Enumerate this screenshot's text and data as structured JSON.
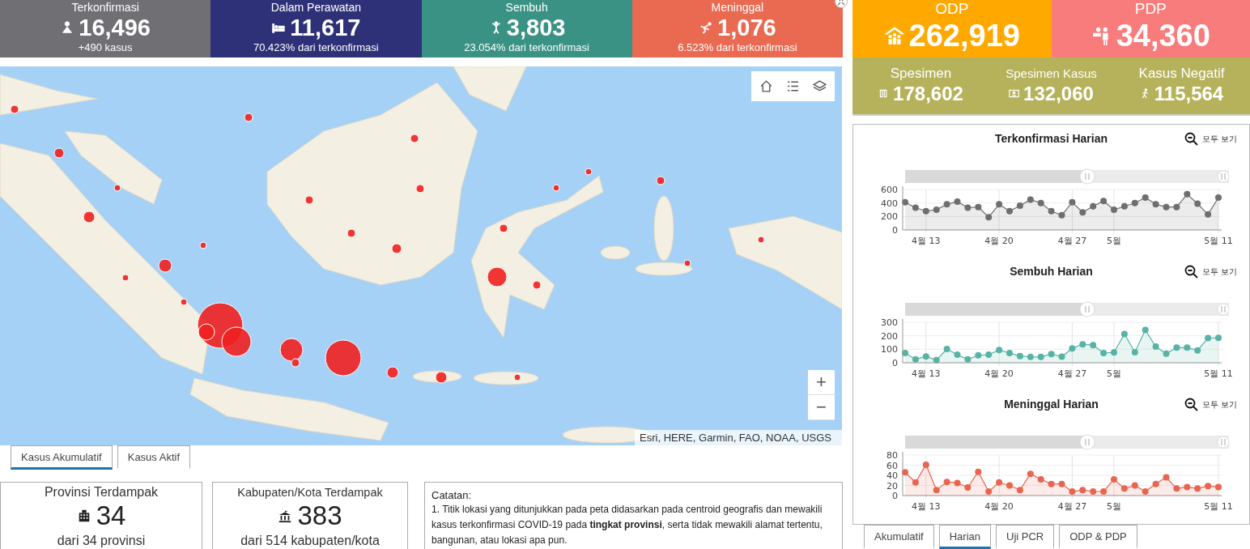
{
  "top_stats": [
    {
      "label": "Terkonfirmasi",
      "value": "16,496",
      "sub": "+490 kasus",
      "color": "#6f6f74",
      "kind": "patient"
    },
    {
      "label": "Dalam Perawatan",
      "value": "11,617",
      "sub": "70.423% dari terkonfirmasi",
      "color": "#2e3177",
      "kind": "bed"
    },
    {
      "label": "Sembuh",
      "value": "3,803",
      "sub": "23.054% dari terkonfirmasi",
      "color": "#3a9285",
      "kind": "cheer"
    },
    {
      "label": "Meninggal",
      "value": "1,076",
      "sub": "6.523% dari terkonfirmasi",
      "color": "#e96a50",
      "kind": "fall"
    }
  ],
  "big_stats": [
    {
      "label": "ODP",
      "value": "262,919",
      "color": "#ffa900",
      "kind": "house"
    },
    {
      "label": "PDP",
      "value": "34,360",
      "color": "#f97c7c",
      "kind": "people"
    }
  ],
  "specimen_stats": [
    {
      "label": "Spesimen",
      "value": "178,602",
      "kind": "tubes"
    },
    {
      "label": "Spesimen Kasus",
      "value": "132,060",
      "kind": "card"
    },
    {
      "label": "Kasus Negatif",
      "value": "115,564",
      "kind": "walk"
    }
  ],
  "map": {
    "attribution": "Esri, HERE, Garmin, FAO, NOAA, USGS",
    "zoom_in": "+",
    "zoom_out": "−"
  },
  "map_tabs": [
    {
      "label": "Kasus Akumulatif",
      "selected": true
    },
    {
      "label": "Kasus Aktif",
      "selected": false
    }
  ],
  "region_cards": [
    {
      "title": "Provinsi Terdampak",
      "value": "34",
      "sub": "dari 34 provinsi",
      "kind": "building"
    },
    {
      "title": "Kabupaten/Kota Terdampak",
      "value": "383",
      "sub": "dari 514 kabupaten/kota",
      "kind": "monument"
    }
  ],
  "note": {
    "title": "Catatan:",
    "text": "1. Titik lokasi yang ditunjukkan pada peta didasarkan pada centroid geografis dan mewakili kasus terkonfirmasi COVID-19 pada **tingkat provinsi**, serta tidak mewakili alamat tertentu, bangunan, atau lokasi apa pun."
  },
  "charts": [
    {
      "reset_label": "모두 보기",
      "chart_data": {
        "type": "area",
        "title": "Terkonfirmasi Harian",
        "categories": [
          null,
          null,
          "4월 13",
          null,
          null,
          null,
          null,
          null,
          null,
          "4월 20",
          null,
          null,
          null,
          null,
          null,
          null,
          "4월 27",
          null,
          null,
          null,
          "5월",
          null,
          null,
          null,
          null,
          null,
          null,
          null,
          null,
          null,
          "5월 11"
        ],
        "series": [
          {
            "color": "#6e6e6e",
            "values": [
              410,
              330,
              280,
              300,
              380,
              420,
              330,
              340,
              190,
              380,
              280,
              360,
              450,
              400,
              280,
              220,
              410,
              260,
              350,
              430,
              300,
              350,
              400,
              480,
              380,
              340,
              340,
              530,
              390,
              230,
              480
            ]
          }
        ],
        "ylim": [
          0,
          600
        ],
        "yticks": [
          0,
          200,
          400,
          600
        ],
        "grid": true
      }
    },
    {
      "reset_label": "모두 보기",
      "chart_data": {
        "type": "area",
        "title": "Sembuh Harian",
        "categories": [
          null,
          null,
          "4월 13",
          null,
          null,
          null,
          null,
          null,
          null,
          "4월 20",
          null,
          null,
          null,
          null,
          null,
          null,
          "4월 27",
          null,
          null,
          null,
          "5월",
          null,
          null,
          null,
          null,
          null,
          null,
          null,
          null,
          null,
          "5월 11"
        ],
        "series": [
          {
            "color": "#56b3a6",
            "values": [
              72,
              25,
              47,
              20,
              102,
              60,
              25,
              55,
              60,
              95,
              72,
              50,
              43,
              43,
              65,
              45,
              107,
              137,
              131,
              72,
              77,
              213,
              78,
              243,
              120,
              67,
              112,
              112,
              92,
              183,
              185
            ]
          }
        ],
        "ylim": [
          0,
          300
        ],
        "yticks": [
          0,
          100,
          200,
          300
        ],
        "grid": true
      }
    },
    {
      "reset_label": "모두 보기",
      "chart_data": {
        "type": "area",
        "title": "Meninggal Harian",
        "categories": [
          null,
          null,
          "4월 13",
          null,
          null,
          null,
          null,
          null,
          null,
          "4월 20",
          null,
          null,
          null,
          null,
          null,
          null,
          "4월 27",
          null,
          null,
          null,
          "5월",
          null,
          null,
          null,
          null,
          null,
          null,
          null,
          null,
          null,
          "5월 11"
        ],
        "series": [
          {
            "color": "#e8654f",
            "values": [
              46,
              26,
              61,
              11,
              27,
              25,
              16,
              47,
              8,
              26,
              20,
              11,
              43,
              32,
              23,
              23,
              8,
              11,
              8,
              8,
              32,
              14,
              20,
              8,
              23,
              36,
              14,
              17,
              14,
              19,
              17
            ]
          }
        ],
        "ylim": [
          0,
          80
        ],
        "yticks": [
          0,
          20,
          40,
          60,
          80
        ],
        "grid": true
      }
    }
  ],
  "chart_tabs": [
    {
      "label": "Akumulatif",
      "selected": false
    },
    {
      "label": "Harian",
      "selected": true
    },
    {
      "label": "Uji PCR",
      "selected": false
    },
    {
      "label": "ODP & PDP",
      "selected": false
    }
  ]
}
